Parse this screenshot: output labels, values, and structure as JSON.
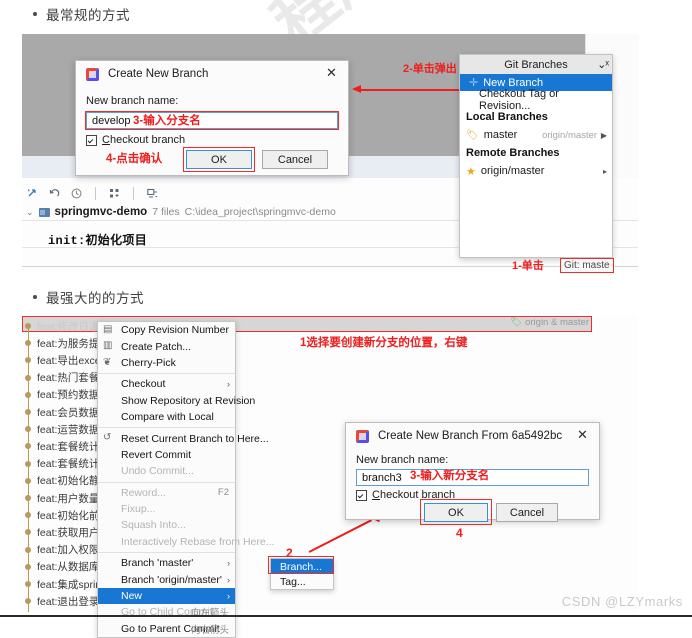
{
  "headings": {
    "section1": "最常规的方式",
    "section2": "最强大的的方式"
  },
  "watermark": {
    "text": "程序员 北京昌平校区",
    "csdn": "CSDN @LZYmarks"
  },
  "shot1": {
    "toolbar_icons": [
      "expand-icon",
      "revert-icon",
      "history-icon",
      "branch-filter-icon",
      "show-diff-icon"
    ],
    "project": {
      "chevron": "⌄",
      "name": "springmvc-demo",
      "files": "7 files",
      "path": "C:\\idea_project\\springmvc-demo"
    },
    "init_line": "init:初始化项目"
  },
  "dialog1": {
    "title": "Create New Branch",
    "close": "✕",
    "label": "New branch name:",
    "input_value": "develop",
    "checkbox_label_underlined": "C",
    "checkbox_label_rest": "heckout branch",
    "checkbox_checked": true,
    "ok": "OK",
    "cancel": "Cancel"
  },
  "git_popup": {
    "title": "Git Branches",
    "pin": "⌄ˣ",
    "items": [
      {
        "label": "New Branch",
        "icon": "plus-icon",
        "selected": true
      },
      {
        "label": "Checkout Tag or Revision...",
        "icon": "",
        "selected": false
      }
    ],
    "local_header": "Local Branches",
    "local_branches": [
      {
        "name": "master",
        "tracking": "origin/master",
        "icon": "tag-icon",
        "arrow": "▶"
      }
    ],
    "remote_header": "Remote Branches",
    "remote_branches": [
      {
        "name": "origin/master",
        "icon": "star-icon",
        "arrow": "▸"
      }
    ]
  },
  "status_chip": "Git: maste",
  "annotations_top": {
    "a1": "1-单击",
    "a2": "2-单击弹出",
    "a3": "3-输入分支名",
    "a4": "4-点击确认"
  },
  "shot2": {
    "topbar_label": "origin & master",
    "annotation_right_click": "1选择要创建新分支的位置，右键",
    "commits": [
      "feat:修改日志输出位置",
      "feat:为服务提供",
      "feat:导出excel",
      "feat:热门套餐语",
      "feat:预约数据语",
      "feat:会员数据语",
      "feat:运营数据分",
      "feat:套餐统计分",
      "feat:套餐统计分",
      "feat:初始化静态",
      "feat:用户数量折",
      "feat:初始化前端",
      "feat:获取用户信",
      "feat:加入权限控",
      "feat:从数据库动",
      "feat:集成spring",
      "feat:退出登录"
    ]
  },
  "context_menu": {
    "items": [
      {
        "label": "Copy Revision Number",
        "icon": "copy-icon",
        "state": "normal",
        "submenu": false,
        "accel": ""
      },
      {
        "label": "Create Patch...",
        "icon": "patch-icon",
        "state": "normal",
        "submenu": false,
        "accel": ""
      },
      {
        "label": "Cherry-Pick",
        "icon": "cherry-icon",
        "state": "normal",
        "submenu": false,
        "accel": ""
      },
      {
        "sep": true
      },
      {
        "label": "Checkout",
        "icon": "",
        "state": "normal",
        "submenu": true,
        "accel": ""
      },
      {
        "label": "Show Repository at Revision",
        "icon": "",
        "state": "normal",
        "submenu": false,
        "accel": ""
      },
      {
        "label": "Compare with Local",
        "icon": "",
        "state": "normal",
        "submenu": false,
        "accel": ""
      },
      {
        "sep": true
      },
      {
        "label": "Reset Current Branch to Here...",
        "icon": "reset-icon",
        "state": "normal",
        "submenu": false,
        "accel": ""
      },
      {
        "label": "Revert Commit",
        "icon": "",
        "state": "normal",
        "submenu": false,
        "accel": ""
      },
      {
        "label": "Undo Commit...",
        "icon": "",
        "state": "disabled",
        "submenu": false,
        "accel": ""
      },
      {
        "sep": true
      },
      {
        "label": "Reword...",
        "icon": "",
        "state": "disabled",
        "submenu": false,
        "accel": "F2"
      },
      {
        "label": "Fixup...",
        "icon": "",
        "state": "disabled",
        "submenu": false,
        "accel": ""
      },
      {
        "label": "Squash Into...",
        "icon": "",
        "state": "disabled",
        "submenu": false,
        "accel": ""
      },
      {
        "label": "Interactively Rebase from Here...",
        "icon": "",
        "state": "disabled",
        "submenu": false,
        "accel": ""
      },
      {
        "sep": true
      },
      {
        "label": "Branch 'master'",
        "icon": "",
        "state": "normal",
        "submenu": true,
        "accel": ""
      },
      {
        "label": "Branch 'origin/master'",
        "icon": "",
        "state": "normal",
        "submenu": true,
        "accel": ""
      },
      {
        "label": "New",
        "icon": "",
        "state": "selected",
        "submenu": true,
        "accel": ""
      },
      {
        "label": "Go to Child Commit",
        "icon": "",
        "state": "disabled",
        "submenu": false,
        "accel": "向左箭头"
      },
      {
        "label": "Go to Parent Commit",
        "icon": "",
        "state": "normal",
        "submenu": false,
        "accel": "向右箭头"
      }
    ]
  },
  "submenu": {
    "items": [
      {
        "label": "Branch...",
        "selected": true
      },
      {
        "label": "Tag...",
        "selected": false
      }
    ],
    "marker": "2"
  },
  "dialog2": {
    "title": "Create New Branch From 6a5492bc",
    "close": "✕",
    "label": "New branch name:",
    "input_value": "branch3",
    "checkbox_label_underlined": "C",
    "checkbox_label_rest": "heckout branch",
    "checkbox_checked": true,
    "ok": "OK",
    "cancel": "Cancel",
    "annotation_input": "3-输入新分支名",
    "annotation_ok": "4"
  },
  "colors": {
    "annotation_red": "#ef1d1d",
    "selection_blue": "#1977d4",
    "input_border_blue": "#5f9fd8",
    "graph_node": "#b99a5b",
    "gray_panel": "#a9a9a9"
  }
}
